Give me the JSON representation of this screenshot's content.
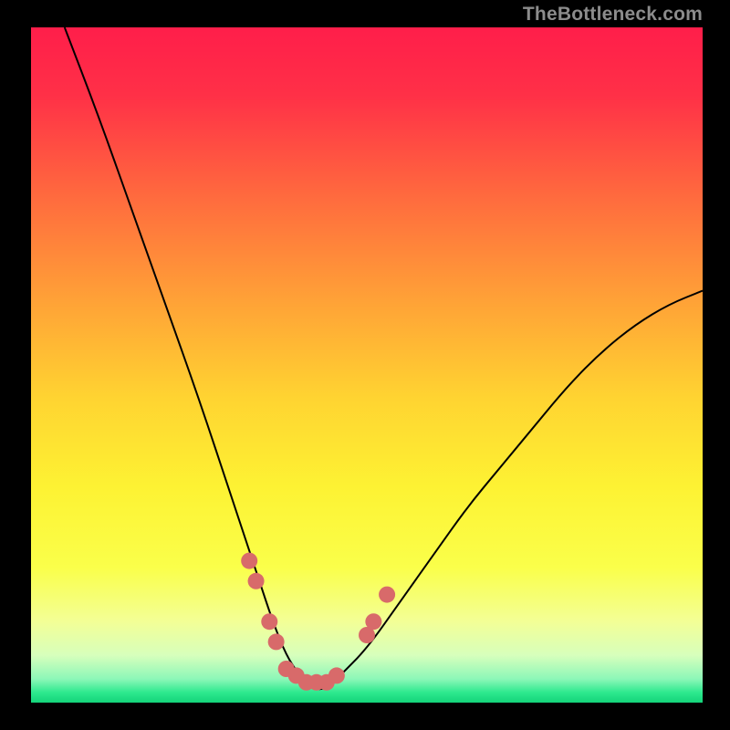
{
  "watermark": "TheBottleneck.com",
  "chart_data": {
    "type": "line",
    "title": "",
    "xlabel": "",
    "ylabel": "",
    "xlim": [
      0,
      100
    ],
    "ylim": [
      0,
      100
    ],
    "grid": false,
    "legend": false,
    "series": [
      {
        "name": "bottleneck-curve",
        "color": "#000000",
        "x": [
          5,
          10,
          15,
          20,
          25,
          30,
          32,
          34,
          36,
          38,
          40,
          42,
          44,
          46,
          50,
          55,
          60,
          65,
          70,
          75,
          80,
          85,
          90,
          95,
          100
        ],
        "y": [
          100,
          87,
          73,
          59,
          45,
          30,
          24,
          18,
          12,
          7,
          4,
          2,
          2,
          4,
          8,
          15,
          22,
          29,
          35,
          41,
          47,
          52,
          56,
          59,
          61
        ]
      }
    ],
    "markers": [
      {
        "x": 32.5,
        "y": 21,
        "size": 9,
        "color": "#d86a6a"
      },
      {
        "x": 33.5,
        "y": 18,
        "size": 9,
        "color": "#d86a6a"
      },
      {
        "x": 35.5,
        "y": 12,
        "size": 9,
        "color": "#d86a6a"
      },
      {
        "x": 36.5,
        "y": 9,
        "size": 9,
        "color": "#d86a6a"
      },
      {
        "x": 38.0,
        "y": 5,
        "size": 9,
        "color": "#d86a6a"
      },
      {
        "x": 39.5,
        "y": 4,
        "size": 9,
        "color": "#d86a6a"
      },
      {
        "x": 41.0,
        "y": 3,
        "size": 9,
        "color": "#d86a6a"
      },
      {
        "x": 42.5,
        "y": 3,
        "size": 9,
        "color": "#d86a6a"
      },
      {
        "x": 44.0,
        "y": 3,
        "size": 9,
        "color": "#d86a6a"
      },
      {
        "x": 45.5,
        "y": 4,
        "size": 9,
        "color": "#d86a6a"
      },
      {
        "x": 50.0,
        "y": 10,
        "size": 9,
        "color": "#d86a6a"
      },
      {
        "x": 51.0,
        "y": 12,
        "size": 9,
        "color": "#d86a6a"
      },
      {
        "x": 53.0,
        "y": 16,
        "size": 9,
        "color": "#d86a6a"
      }
    ],
    "background_gradient": {
      "stops": [
        {
          "pos": 0.0,
          "color": "#ff1e4a"
        },
        {
          "pos": 0.1,
          "color": "#ff3047"
        },
        {
          "pos": 0.25,
          "color": "#ff6a3e"
        },
        {
          "pos": 0.4,
          "color": "#ffa037"
        },
        {
          "pos": 0.55,
          "color": "#ffd431"
        },
        {
          "pos": 0.68,
          "color": "#fdf233"
        },
        {
          "pos": 0.8,
          "color": "#faff4a"
        },
        {
          "pos": 0.88,
          "color": "#f3ff96"
        },
        {
          "pos": 0.93,
          "color": "#d7ffbc"
        },
        {
          "pos": 0.965,
          "color": "#8cf7b8"
        },
        {
          "pos": 0.985,
          "color": "#2de98e"
        },
        {
          "pos": 1.0,
          "color": "#14d47a"
        }
      ]
    }
  }
}
